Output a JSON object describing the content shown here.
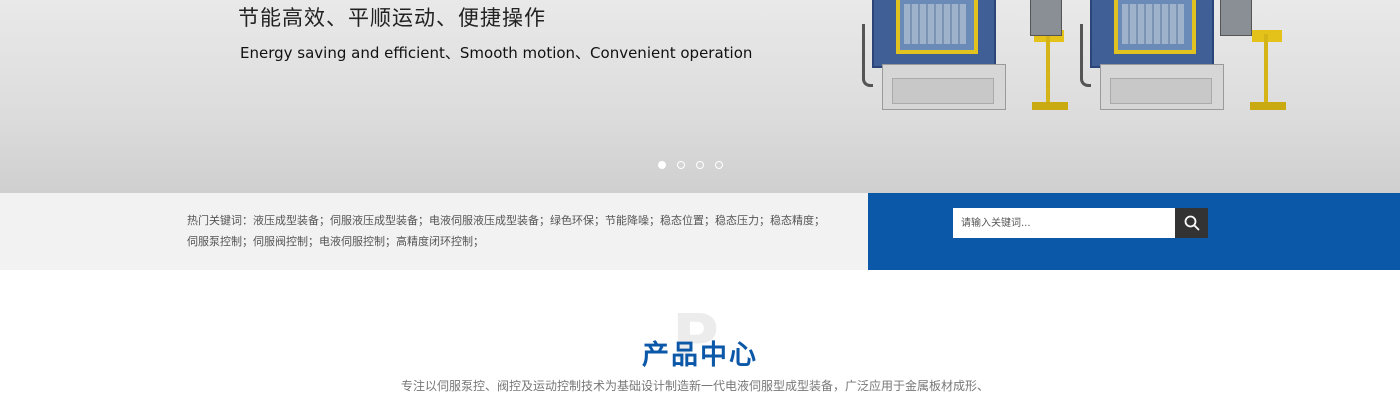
{
  "banner": {
    "headline": "节能高效、平顺运动、便捷操作",
    "subline": "Energy saving and efficient、Smooth motion、Convenient operation",
    "slides": [
      {
        "active": true
      },
      {
        "active": false
      },
      {
        "active": false
      },
      {
        "active": false
      }
    ]
  },
  "keywords": {
    "text": "热门关键词：液压成型装备；伺服液压成型装备；电液伺服液压成型装备；绿色环保；节能降噪；稳态位置；稳态压力；稳态精度；伺服泵控制；伺服阀控制；电液伺服控制；高精度闭环控制；"
  },
  "search": {
    "placeholder": "请输入关键词...",
    "icon": "search-icon"
  },
  "products": {
    "title": "产品中心",
    "ghost_letter": "P",
    "description": "专注以伺服泵控、阀控及运动控制技术为基础设计制造新一代电液伺服型成型装备，广泛应用于金属板材成形、"
  },
  "colors": {
    "brand_blue": "#0b57a8",
    "search_button": "#333333"
  }
}
